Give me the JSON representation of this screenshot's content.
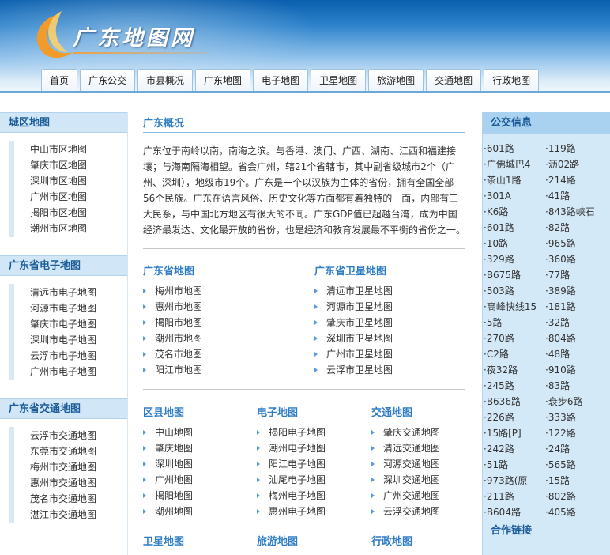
{
  "site": {
    "logo_text": "广东地图网"
  },
  "nav": [
    "首页",
    "广东公交",
    "市县概况",
    "广东地图",
    "电子地图",
    "卫星地图",
    "旅游地图",
    "交通地图",
    "行政地图"
  ],
  "left": {
    "district": {
      "title": "城区地图",
      "items": [
        "中山市区地图",
        "肇庆市区地图",
        "深圳市区地图",
        "广州市区地图",
        "揭阳市区地图",
        "潮州市区地图"
      ]
    },
    "electronic": {
      "title": "广东省电子地图",
      "items": [
        "清远市电子地图",
        "河源市电子地图",
        "肇庆市电子地图",
        "深圳市电子地图",
        "云浮市电子地图",
        "广州市电子地图"
      ]
    },
    "traffic": {
      "title": "广东省交通地图",
      "items": [
        "云浮市交通地图",
        "东莞市交通地图",
        "梅州市交通地图",
        "惠州市交通地图",
        "茂名市交通地图",
        "湛江市交通地图"
      ]
    }
  },
  "center": {
    "overview_title": "广东概况",
    "overview_text": "广东位于南岭以南，南海之滨。与香港、澳门、广西、湖南、江西和福建接壤；与海南隔海相望。省会广州，辖21个省辖市，其中副省级城市2个（广州、深圳），地级市19个。广东是一个以汉族为主体的省份，拥有全国全部56个民族。广东在语言风俗、历史文化等方面都有着独特的一面，内部有三大民系，与中国北方地区有很大的不同。广东GDP值已超越台湾，成为中国经济最发达、文化最开放的省份，也是经济和教育发展最不平衡的省份之一。",
    "province_map": {
      "title": "广东省地图",
      "items": [
        "梅州市地图",
        "惠州市地图",
        "揭阳市地图",
        "潮州市地图",
        "茂名市地图",
        "阳江市地图"
      ]
    },
    "province_satellite": {
      "title": "广东省卫星地图",
      "items": [
        "清远市卫星地图",
        "河源市卫星地图",
        "肇庆市卫星地图",
        "深圳市卫星地图",
        "广州市卫星地图",
        "云浮市卫星地图"
      ]
    },
    "county_map": {
      "title": "区县地图",
      "items": [
        "中山地图",
        "肇庆地图",
        "深圳地图",
        "广州地图",
        "揭阳地图",
        "潮州地图"
      ]
    },
    "electronic_map": {
      "title": "电子地图",
      "items": [
        "揭阳电子地图",
        "潮州电子地图",
        "阳江电子地图",
        "汕尾电子地图",
        "梅州电子地图",
        "惠州电子地图"
      ]
    },
    "traffic_map": {
      "title": "交通地图",
      "items": [
        "肇庆交通地图",
        "清远交通地图",
        "河源交通地图",
        "深圳交通地图",
        "广州交通地图",
        "云浮交通地图"
      ]
    },
    "bottom_titles": [
      "卫星地图",
      "旅游地图",
      "行政地图"
    ]
  },
  "right": {
    "title": "公交信息",
    "bus_routes": [
      "·601路",
      "·119路",
      "·广佛城巴4",
      "·沥02路",
      "·茶山1路",
      "·214路",
      "·301A",
      "·41路",
      "·K6路",
      "·843路峡石",
      "·601路",
      "·82路",
      "·10路",
      "·965路",
      "·329路",
      "·360路",
      "·B675路",
      "·77路",
      "·503路",
      "·389路",
      "·高峰快线15",
      "·181路",
      "·5路",
      "·32路",
      "·270路",
      "·804路",
      "·C2路",
      "·48路",
      "·夜32路",
      "·910路",
      "·245路",
      "·83路",
      "·B636路",
      "·衰步6路",
      "·226路",
      "·333路",
      "·15路[P]",
      "·122路",
      "·242路",
      "·24路",
      "·51路",
      "·565路",
      "·973路(原",
      "·15路",
      "·211路",
      "·802路",
      "·B604路",
      "·405路"
    ],
    "partner_title": "合作链接"
  },
  "colors": {
    "accent": "#2f7dc5",
    "header_blue": "#0a5fae",
    "side_head_bg": "#d1e7f8",
    "right_bg": "#d4e9f8"
  }
}
